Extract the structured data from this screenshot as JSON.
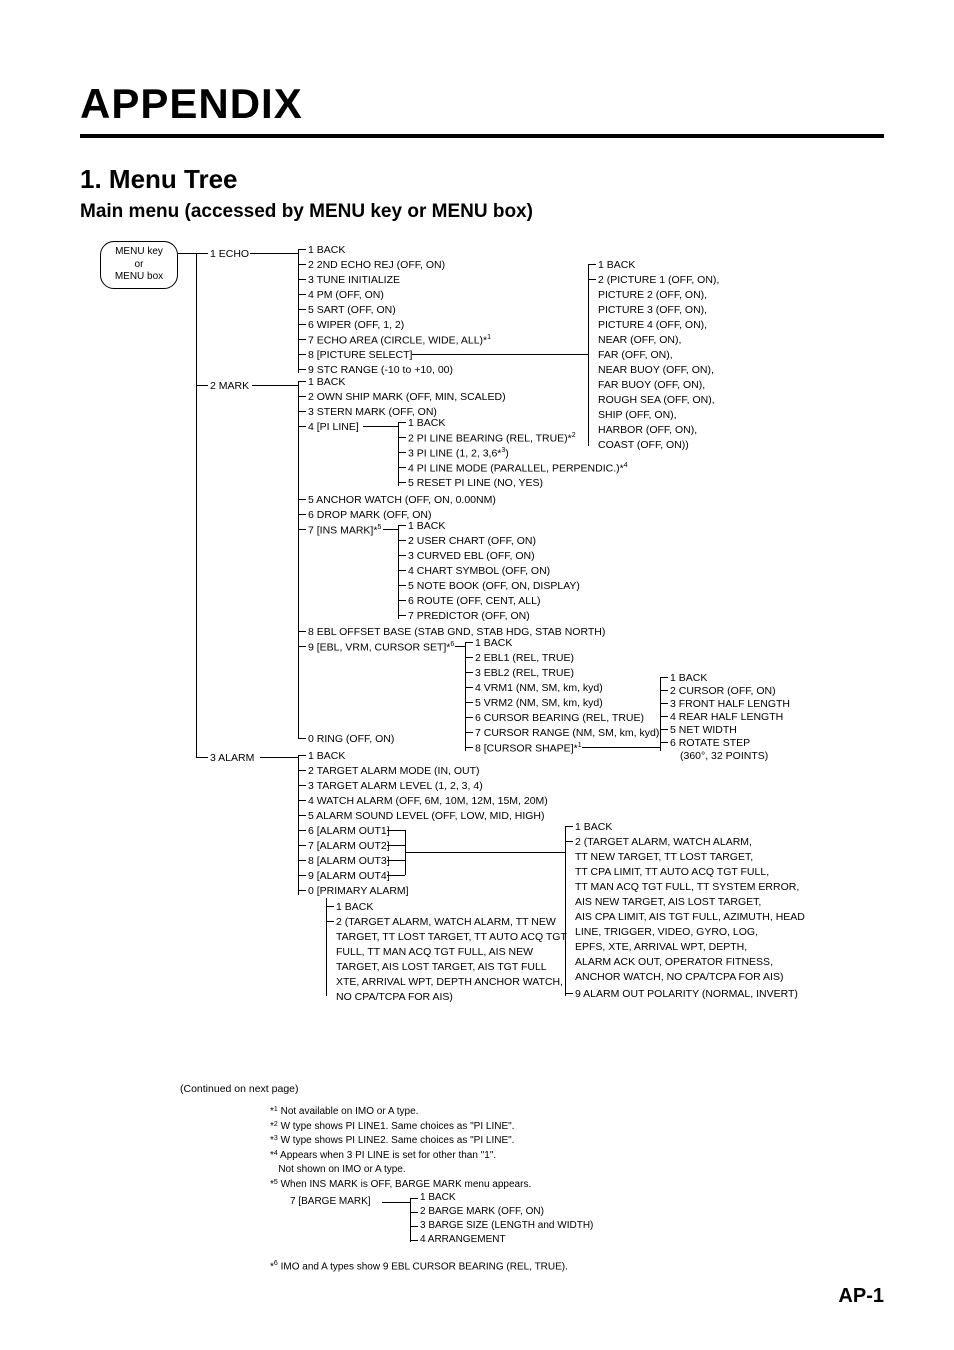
{
  "title": "APPENDIX",
  "section_number": "1. Menu Tree",
  "subtitle": "Main menu (accessed by MENU key or MENU box)",
  "root_label": "MENU key\nor\nMENU box",
  "branches": {
    "echo": {
      "label": "1 ECHO",
      "items": [
        "1 BACK",
        "2 2ND ECHO REJ (OFF, ON)",
        "3 TUNE INITIALIZE",
        "4 PM (OFF, ON)",
        "5 SART (OFF, ON)",
        "6 WIPER (OFF, 1, 2)",
        "7 ECHO AREA (CIRCLE, WIDE, ALL)*1",
        "8 [PICTURE SELECT]",
        "9 STC RANGE (-10 to +10, 00)"
      ],
      "picture_select": [
        "1 BACK",
        "2 (PICTURE 1 (OFF, ON),",
        "PICTURE 2 (OFF, ON),",
        "PICTURE 3 (OFF, ON),",
        "PICTURE 4 (OFF, ON),",
        "NEAR (OFF, ON),",
        "FAR (OFF, ON),",
        "NEAR BUOY (OFF, ON),",
        "FAR BUOY (OFF, ON),",
        "ROUGH SEA (OFF, ON),",
        "SHIP (OFF, ON),",
        "HARBOR (OFF, ON),",
        "COAST (OFF, ON))"
      ]
    },
    "mark": {
      "label": "2 MARK",
      "items": [
        "1 BACK",
        "2 OWN SHIP MARK (OFF, MIN, SCALED)",
        "3 STERN MARK (OFF, ON)",
        "4 [PI LINE]",
        "5 ANCHOR WATCH (OFF, ON, 0.00NM)",
        "6 DROP MARK (OFF, ON)",
        "7 [INS MARK]*5",
        "8 EBL OFFSET BASE (STAB GND, STAB HDG, STAB NORTH)",
        "9 [EBL, VRM, CURSOR SET]*6",
        "0 RING (OFF, ON)"
      ],
      "pi_line": [
        "1 BACK",
        "2 PI LINE BEARING (REL, TRUE)*2",
        "3 PI LINE (1, 2, 3,6*3)",
        "4 PI LINE MODE (PARALLEL, PERPENDIC.)*4",
        "5 RESET PI LINE (NO, YES)"
      ],
      "ins_mark": [
        "1 BACK",
        "2 USER CHART (OFF, ON)",
        "3 CURVED EBL (OFF, ON)",
        "4 CHART SYMBOL (OFF, ON)",
        "5 NOTE BOOK (OFF, ON, DISPLAY)",
        "6 ROUTE (OFF, CENT, ALL)",
        "7 PREDICTOR (OFF, ON)"
      ],
      "ebl_vrm": [
        "1 BACK",
        "2 EBL1 (REL, TRUE)",
        "3 EBL2 (REL, TRUE)",
        "4 VRM1 (NM, SM, km, kyd)",
        "5 VRM2 (NM, SM, km, kyd)",
        "6 CURSOR BEARING (REL, TRUE)",
        "7 CURSOR RANGE (NM, SM, km, kyd)",
        "8 [CURSOR SHAPE]*1"
      ],
      "cursor_shape": [
        "1 BACK",
        "2 CURSOR (OFF, ON)",
        "3 FRONT HALF LENGTH",
        "4 REAR HALF LENGTH",
        "5 NET WIDTH",
        "6 ROTATE STEP",
        "   (360°, 32 POINTS)"
      ]
    },
    "alarm": {
      "label": "3 ALARM",
      "items": [
        "1 BACK",
        "2 TARGET ALARM MODE (IN, OUT)",
        "3 TARGET ALARM LEVEL (1, 2, 3, 4)",
        "4 WATCH ALARM (OFF, 6M, 10M, 12M, 15M, 20M)",
        "5 ALARM SOUND LEVEL (OFF, LOW, MID, HIGH)",
        "6 [ALARM OUT1]",
        "7 [ALARM OUT2]",
        "8 [ALARM OUT3]",
        "9 [ALARM OUT4]",
        "0 [PRIMARY ALARM]"
      ],
      "primary_alarm": [
        "1 BACK",
        "2 (TARGET ALARM, WATCH ALARM, TT NEW",
        "TARGET, TT LOST TARGET, TT AUTO ACQ TGT",
        "FULL, TT MAN ACQ TGT FULL, AIS NEW",
        "TARGET, AIS LOST TARGET, AIS TGT FULL",
        "XTE, ARRIVAL WPT, DEPTH ANCHOR WATCH,",
        "NO CPA/TCPA FOR AIS)"
      ],
      "alarm_out": [
        "1 BACK",
        "2 (TARGET ALARM, WATCH ALARM,",
        "   TT NEW TARGET, TT LOST TARGET,",
        "   TT CPA LIMIT, TT AUTO ACQ TGT FULL,",
        "   TT MAN ACQ TGT FULL, TT SYSTEM ERROR,",
        "   AIS NEW TARGET, AIS LOST TARGET,",
        "   AIS CPA LIMIT, AIS TGT FULL, AZIMUTH, HEAD",
        "   LINE, TRIGGER, VIDEO, GYRO, LOG,",
        "   EPFS, XTE, ARRIVAL WPT, DEPTH,",
        "   ALARM ACK OUT, OPERATOR FITNESS,",
        "   ANCHOR WATCH, NO CPA/TCPA FOR AIS)",
        "9 ALARM OUT POLARITY (NORMAL, INVERT)"
      ]
    }
  },
  "continued": "(Continued on next page)",
  "footnotes": [
    "*1 Not available on IMO or A type.",
    "*2 W type shows PI LINE1. Same choices as \"PI LINE\".",
    "*3 W type shows PI LINE2. Same choices as \"PI LINE\".",
    "*4 Appears when 3 PI LINE is set for other than \"1\".",
    "   Not shown on IMO or A type.",
    "*5 When INS MARK is OFF, BARGE MARK menu appears."
  ],
  "barge": {
    "label": "7 [BARGE MARK]",
    "items": [
      "1 BACK",
      "2 BARGE MARK (OFF, ON)",
      "3 BARGE SIZE (LENGTH and WIDTH)",
      "4 ARRANGEMENT"
    ]
  },
  "footnote6": "*6 IMO and A types show 9 EBL CURSOR BEARING (REL, TRUE).",
  "page_number": "AP-1"
}
